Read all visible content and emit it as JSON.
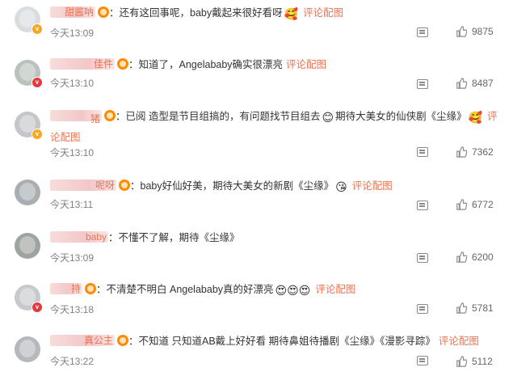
{
  "comments": [
    {
      "user_suffix": "甜酱呐",
      "colon": "：",
      "text": "还有这回事呢，baby戴起来很好看呀",
      "emoji": "🥰",
      "link": "评论配图",
      "time": "今天13:09",
      "likes": "9875",
      "badge": "gold"
    },
    {
      "user_suffix": "佳件",
      "colon": "：",
      "text": "知道了，Angelababy确实很漂亮",
      "emoji": "",
      "link": "评论配图",
      "time": "今天13:10",
      "likes": "8487",
      "badge": "red"
    },
    {
      "user_suffix": "猪",
      "colon": "：",
      "text": "已阅 造型是节目组搞的，有问题找节目组去",
      "emoji": "😊",
      "text2": "期待大美女的仙侠剧《尘缘》",
      "emoji2": "🥰",
      "link": "评论配图",
      "time": "今天13:10",
      "likes": "7362",
      "badge": "gold"
    },
    {
      "user_suffix": "呢呀",
      "colon": "：",
      "text": "baby好仙好美，期待大美女的新剧《尘缘》",
      "emoji": "😘",
      "link": "评论配图",
      "time": "今天13:11",
      "likes": "6772",
      "badge": ""
    },
    {
      "user_suffix": "baby",
      "colon": "：",
      "text": "不懂不了解，期待《尘缘》",
      "emoji": "",
      "link": "",
      "time": "今天13:09",
      "likes": "6200",
      "badge": ""
    },
    {
      "user_suffix": "持",
      "colon": "：",
      "text": "不清楚不明白 Angelababy真的好漂亮",
      "emoji": "😍😍😍",
      "link": "评论配图",
      "time": "今天13:18",
      "likes": "5781",
      "badge": "red"
    },
    {
      "user_suffix": "真公主",
      "colon": "：",
      "text": "不知道 只知道AB戴上好好看 期待鼻姐待播剧《尘缘》《漫影寻踪》",
      "emoji": "",
      "link": "评论配图",
      "time": "今天13:22",
      "likes": "5112",
      "badge": ""
    }
  ],
  "icons": {
    "reply": "reply-icon",
    "like": "thumbs-up-icon",
    "vip": "vip-crown-icon"
  },
  "colors": {
    "link": "#eb7350",
    "meta": "#808080"
  }
}
